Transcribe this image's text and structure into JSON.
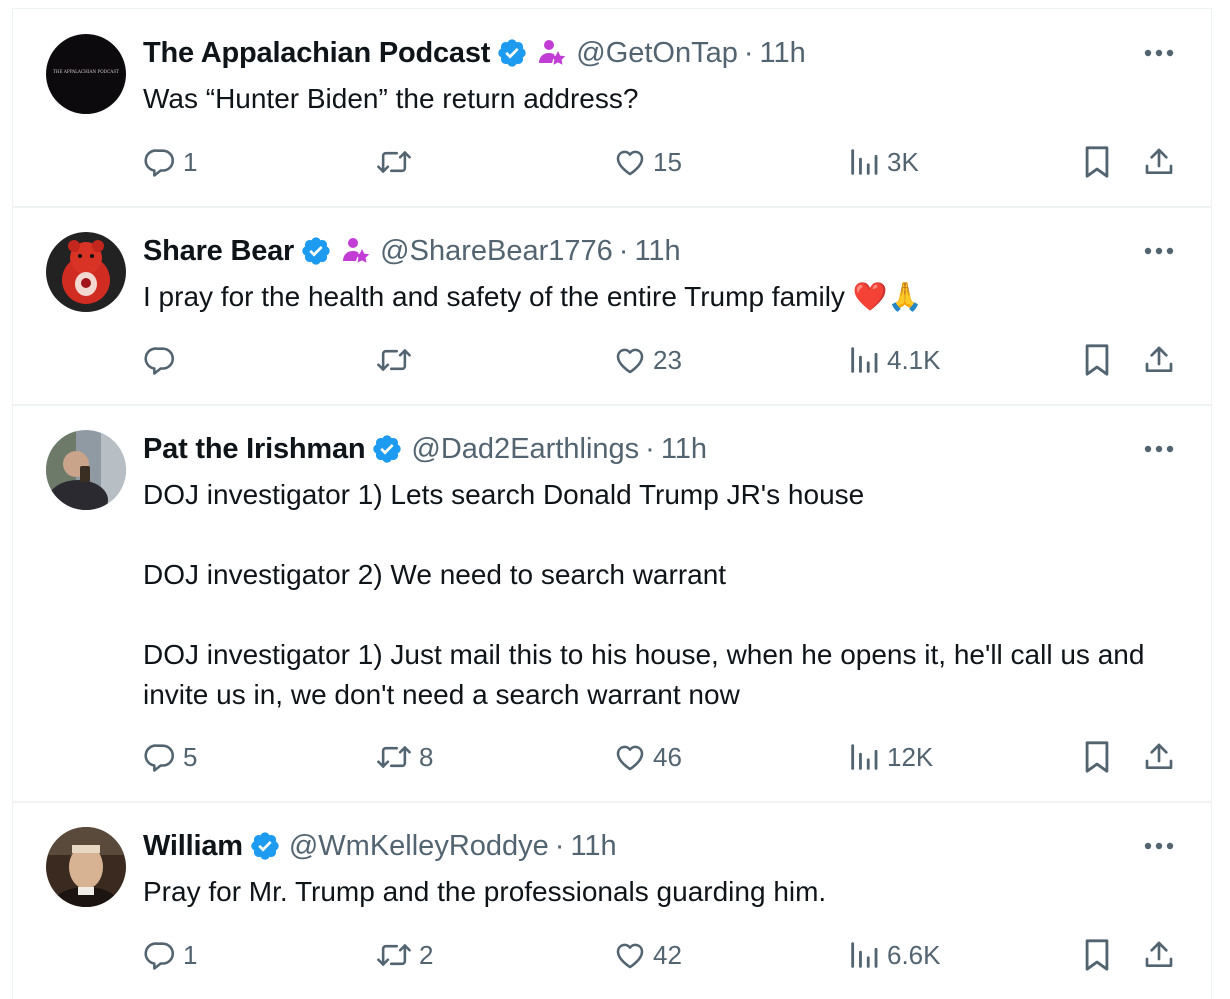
{
  "tweets": [
    {
      "name": "The Appalachian Podcast",
      "handle": "@GetOnTap",
      "time": "11h",
      "avatar_text": "THE APPALACHIAN PODCAST",
      "text": [
        "Was “Hunter Biden” the return address?"
      ],
      "replies": "1",
      "retweets": "",
      "likes": "15",
      "views": "3K",
      "verified": true,
      "affiliate_badge": true
    },
    {
      "name": "Share Bear",
      "handle": "@ShareBear1776",
      "time": "11h",
      "text": [
        "I pray for the health and safety of the entire Trump family ❤️🙏"
      ],
      "replies": "",
      "retweets": "",
      "likes": "23",
      "views": "4.1K",
      "verified": true,
      "affiliate_badge": true
    },
    {
      "name": "Pat the Irishman",
      "handle": "@Dad2Earthlings",
      "time": "11h",
      "text": [
        "DOJ investigator 1) Lets search Donald Trump JR's house",
        "DOJ investigator 2) We need to search warrant",
        "DOJ investigator 1) Just mail this to his house, when he opens it, he'll call us and invite us in, we don't need a search warrant now"
      ],
      "replies": "5",
      "retweets": "8",
      "likes": "46",
      "views": "12K",
      "verified": true,
      "affiliate_badge": false
    },
    {
      "name": "William",
      "handle": "@WmKelleyRoddye",
      "time": "11h",
      "text": [
        "Pray for Mr. Trump and the professionals guarding him."
      ],
      "replies": "1",
      "retweets": "2",
      "likes": "42",
      "views": "6.6K",
      "verified": true,
      "affiliate_badge": false
    }
  ],
  "icons": {
    "reply": "reply-icon",
    "retweet": "retweet-icon",
    "like": "heart-icon",
    "views": "views-icon",
    "bookmark": "bookmark-icon",
    "share": "share-icon",
    "more": "more-icon",
    "verified": "verified-badge-icon",
    "affiliate": "affiliate-badge-icon"
  },
  "colors": {
    "verified": "#1d9bf0",
    "affiliate": "#c23dd6",
    "muted": "#536471",
    "divider": "#eff3f4"
  }
}
